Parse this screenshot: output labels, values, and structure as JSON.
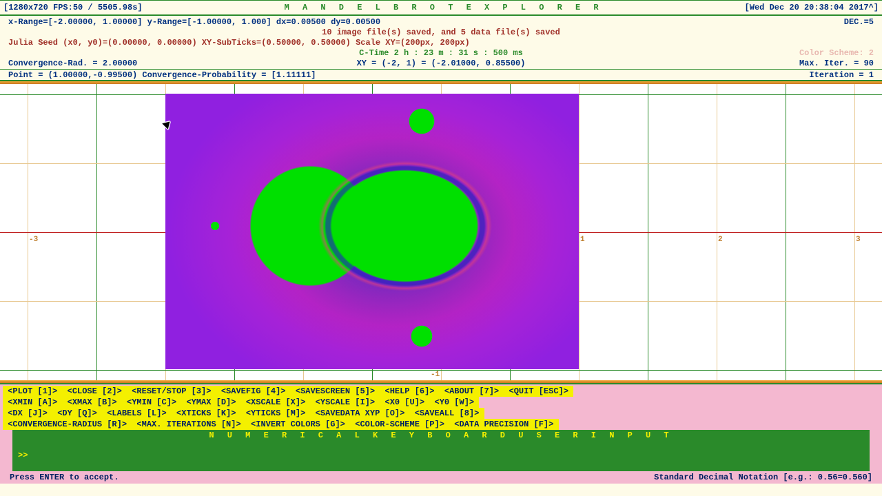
{
  "header": {
    "resolution_fps": "[1280x720 FPS:50 / 5505.98s]",
    "title": "M A N D E L B R O T   E X P L O R E R",
    "datetime": "[Wed Dec 20 20:38:04 2017^]"
  },
  "info": {
    "range": "x-Range=[-2.00000, 1.00000] y-Range=[-1.00000, 1.000] dx=0.00500 dy=0.00500",
    "dec": "DEC.=5",
    "saved": "10 image file(s) saved, and 5 data file(s) saved",
    "julia": "Julia Seed (x0, y0)=(0.00000, 0.00000) XY-SubTicks=(0.50000, 0.50000) Scale XY=(200px, 200px)",
    "ctime": "C-Time 2 h : 23 m : 31 s : 500 ms",
    "conv_rad": "Convergence-Rad. = 2.00000",
    "xy": "XY = (-2, 1) = (-2.01000, 0.85500)",
    "color_scheme": "Color Scheme: 2",
    "max_iter": "Max. Iter. = 90",
    "point": "Point = (1.00000,-0.99500) Convergence-Probability = [1.11111]",
    "iteration": "Iteration = 1"
  },
  "grid_labels": {
    "xm3": "-3",
    "x1": "1",
    "x2": "2",
    "x3": "3",
    "ym1": "-1"
  },
  "commands": {
    "line1": " <PLOT [1]>  <CLOSE [2]>  <RESET/STOP [3]>  <SAVEFIG [4]>  <SAVESCREEN [5]>  <HELP [6]>  <ABOUT [7]>  <QUIT [ESC]> ",
    "line2": " <XMIN [A]>  <XMAX [B]>  <YMIN [C]>  <YMAX [D]>  <XSCALE [X]>  <YSCALE [I]>  <X0 [U]>  <Y0 [W]> ",
    "line3": " <DX [J]>  <DY [Q]>  <LABELS [L]>  <XTICKS [K]>  <YTICKS [M]>  <SAVEDATA XYP [O]>  <SAVEALL [8]> ",
    "line4": " <CONVERGENCE-RADIUS [R]>  <MAX. ITERATIONS [N]>  <INVERT COLORS [G]>  <COLOR-SCHEME [P]>  <DATA PRECISION [F]> "
  },
  "input": {
    "header": "N U M E R I C A L   K E Y B O A R D   U S E R   I N P U T",
    "prompt": ">> "
  },
  "footer": {
    "left": "Press ENTER to accept.",
    "right": "Standard Decimal Notation [e.g.: 0.56=0.560]"
  }
}
